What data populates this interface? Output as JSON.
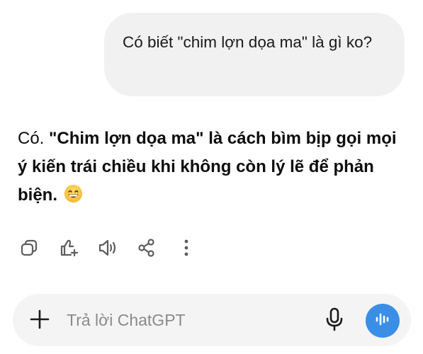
{
  "user_message": {
    "text": "Có biết \"chim lợn dọa ma\" là gì ko?"
  },
  "assistant_message": {
    "prefix": "Có. ",
    "bold_text": "\"Chim lợn dọa ma\" là cách bìm bịp gọi mọi ý kiến trái chiều khi không còn lý lẽ để phản biện.",
    "emoji": "grinning-face-with-smiling-eyes"
  },
  "message_actions": {
    "icons": [
      "copy-icon",
      "thumbs-up-icon",
      "read-aloud-icon",
      "share-icon",
      "more-options-icon"
    ]
  },
  "composer": {
    "placeholder": "Trả lời ChatGPT",
    "value": "",
    "plus_icon": "plus-icon",
    "mic_icon": "microphone-icon",
    "voice_icon": "voice-mode-icon"
  },
  "colors": {
    "user_bubble_bg": "#f1f1f1",
    "composer_bg": "#f4f4f4",
    "voice_button": "#3a8ee6",
    "icon": "#5d5d5d"
  }
}
